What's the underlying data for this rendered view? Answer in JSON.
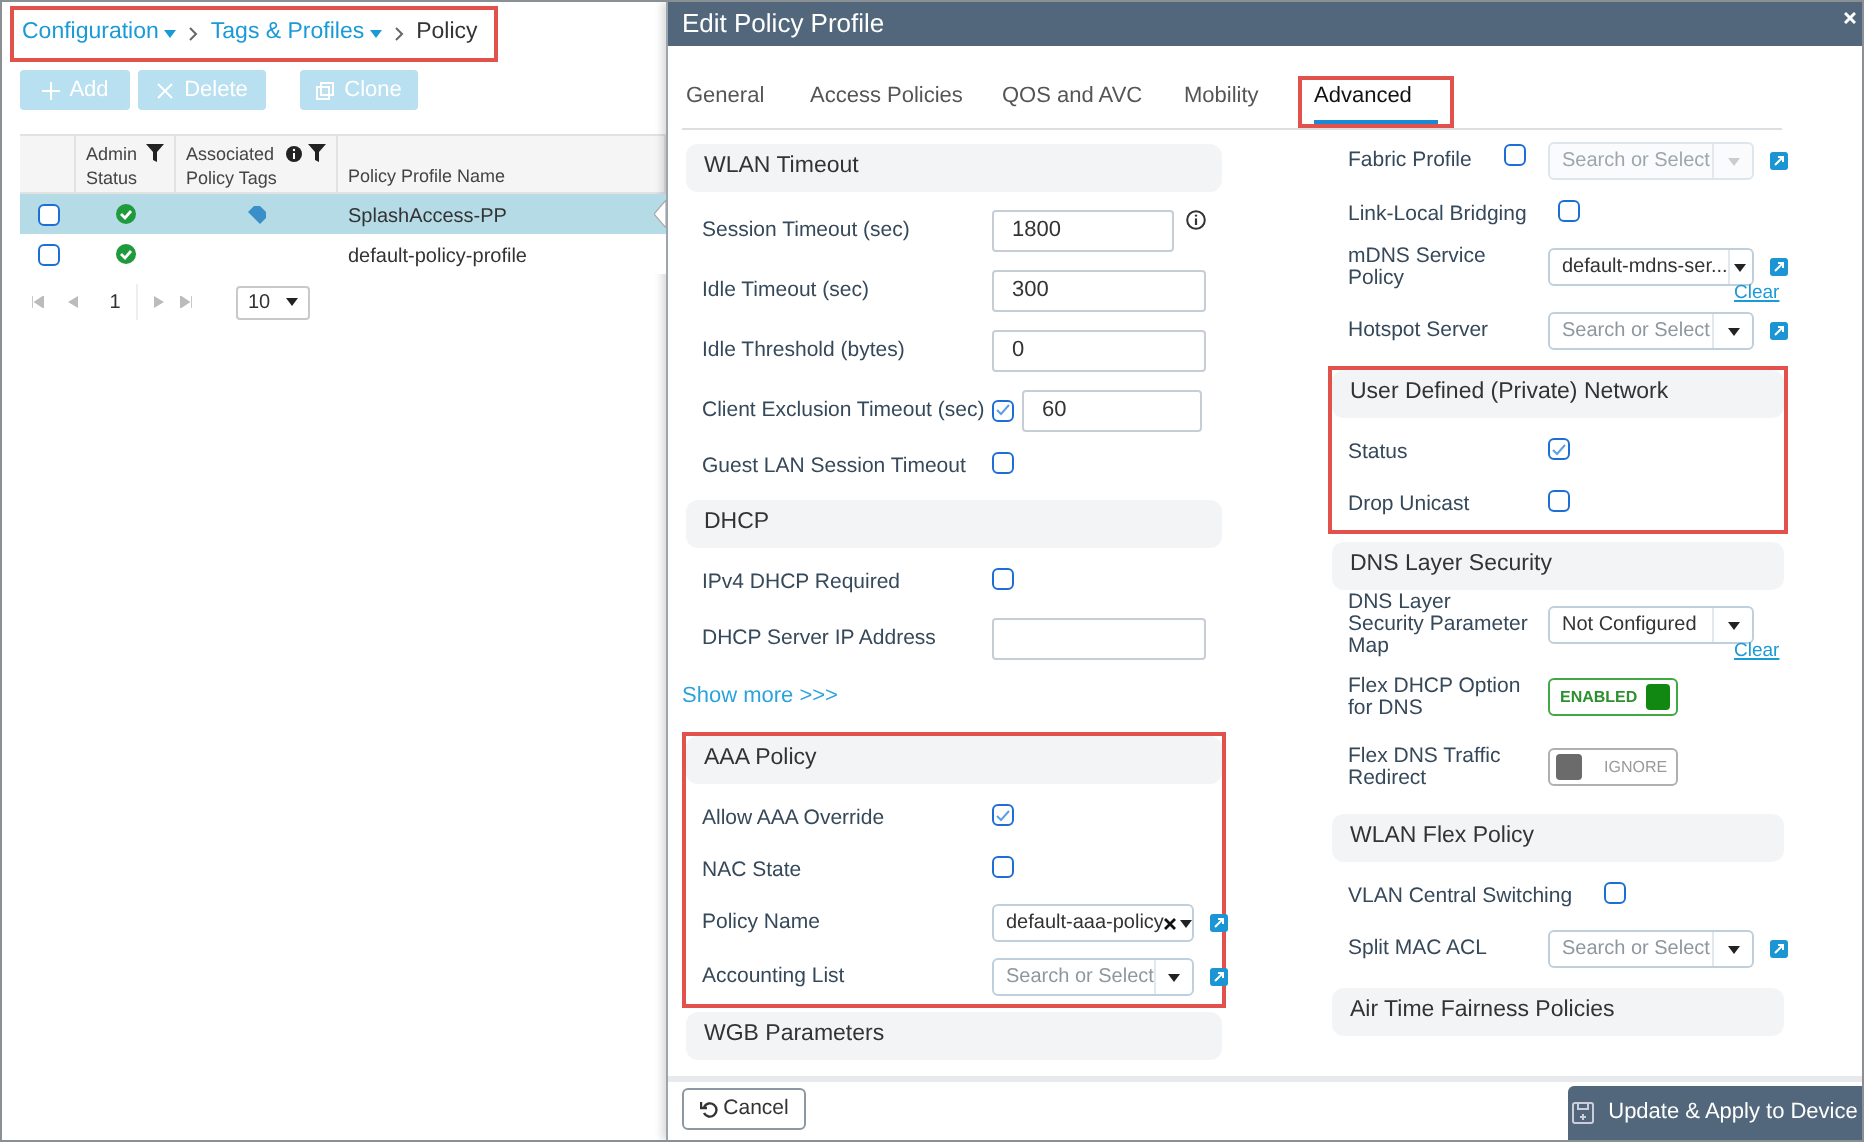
{
  "breadcrumb": {
    "highlighted": true,
    "items": [
      {
        "label": "Configuration",
        "dropdown": true
      },
      {
        "label": "Tags & Profiles",
        "dropdown": true
      },
      {
        "label": "Policy"
      }
    ]
  },
  "toolbar": [
    {
      "kind": "add",
      "label": "Add",
      "disabled": true
    },
    {
      "kind": "delete",
      "label": "Delete",
      "disabled": true
    },
    {
      "kind": "clone",
      "label": "Clone",
      "disabled": true
    }
  ],
  "table": {
    "columns": [
      {
        "label": "Admin Status",
        "filter": true
      },
      {
        "label": "Associated Policy Tags",
        "info": true,
        "filter": true
      },
      {
        "label": "Policy Profile Name"
      }
    ],
    "rows": [
      {
        "selected": true,
        "checked": false,
        "admin_enabled": true,
        "policy_tag": true,
        "name": "SplashAccess-PP"
      },
      {
        "selected": false,
        "checked": false,
        "admin_enabled": true,
        "name": "default-policy-profile"
      }
    ],
    "pager": {
      "page": "1",
      "page_size": "10"
    }
  },
  "dialog": {
    "title": "Edit Policy Profile",
    "tabs": [
      {
        "label": "General",
        "selected": false
      },
      {
        "label": "Access Policies",
        "selected": false
      },
      {
        "label": "QOS and AVC",
        "selected": false
      },
      {
        "label": "Mobility",
        "selected": false
      },
      {
        "label": "Advanced",
        "selected": true,
        "highlighted": true
      }
    ],
    "left_column": [
      {
        "kind": "section",
        "title": "WLAN Timeout",
        "rows": [
          {
            "kind": "input",
            "label": "Session Timeout (sec)",
            "value": "1800",
            "info": true
          },
          {
            "kind": "input",
            "label": "Idle Timeout (sec)",
            "value": "300"
          },
          {
            "kind": "input",
            "label": "Idle Threshold (bytes)",
            "value": "0"
          },
          {
            "kind": "checkbox_input",
            "label": "Client Exclusion Timeout (sec)",
            "checked": true,
            "value": "60"
          },
          {
            "kind": "checkbox",
            "label": "Guest LAN Session Timeout",
            "checked": false
          }
        ]
      },
      {
        "kind": "section",
        "title": "DHCP",
        "rows": [
          {
            "kind": "checkbox",
            "label": "IPv4 DHCP Required",
            "checked": false
          },
          {
            "kind": "input",
            "label": "DHCP Server IP Address"
          }
        ]
      },
      {
        "kind": "link",
        "label": "Show more >>>"
      },
      {
        "kind": "section",
        "title": "AAA Policy",
        "highlighted": true,
        "rows": [
          {
            "kind": "checkbox",
            "label": "Allow AAA Override",
            "checked": true
          },
          {
            "kind": "checkbox",
            "label": "NAC State",
            "checked": false
          },
          {
            "kind": "select",
            "label": "Policy Name",
            "value": "default-aaa-policy",
            "clearable": true,
            "edit": true
          },
          {
            "kind": "select",
            "label": "Accounting List",
            "placeholder": "Search or Select",
            "edit": true
          }
        ]
      },
      {
        "kind": "section",
        "title": "WGB Parameters"
      }
    ],
    "right_column": [
      {
        "kind": "group",
        "rows": [
          {
            "kind": "checkbox_select",
            "label": "Fabric Profile",
            "checked": false,
            "placeholder": "Search or Select",
            "disabled": true,
            "edit": true
          },
          {
            "kind": "checkbox",
            "label": "Link-Local Bridging",
            "checked": false
          },
          {
            "kind": "select",
            "label": "mDNS Service Policy",
            "value": "default-mdns-ser...",
            "edit": true,
            "clear_link": "Clear"
          },
          {
            "kind": "select",
            "label": "Hotspot Server",
            "placeholder": "Search or Select",
            "edit": true
          }
        ]
      },
      {
        "kind": "section",
        "title": "User Defined (Private) Network",
        "highlighted": true,
        "rows": [
          {
            "kind": "checkbox",
            "label": "Status",
            "checked": true
          },
          {
            "kind": "checkbox",
            "label": "Drop Unicast",
            "checked": false
          }
        ]
      },
      {
        "kind": "section",
        "title": "DNS Layer Security",
        "rows": [
          {
            "kind": "select",
            "label": "DNS Layer Security Parameter Map",
            "value": "Not Configured",
            "clear_link": "Clear"
          },
          {
            "kind": "toggle",
            "label": "Flex DHCP Option for DNS",
            "on": true,
            "text": "ENABLED"
          },
          {
            "kind": "toggle",
            "label": "Flex DNS Traffic Redirect",
            "on": false,
            "text": "IGNORE"
          }
        ]
      },
      {
        "kind": "section",
        "title": "WLAN Flex Policy",
        "rows": [
          {
            "kind": "checkbox",
            "label": "VLAN Central Switching",
            "checked": false
          },
          {
            "kind": "select",
            "label": "Split MAC ACL",
            "placeholder": "Search or Select",
            "edit": true
          }
        ]
      },
      {
        "kind": "section",
        "title": "Air Time Fairness Policies"
      }
    ],
    "footer": {
      "cancel": "Cancel",
      "apply": "Update & Apply to Device"
    }
  }
}
